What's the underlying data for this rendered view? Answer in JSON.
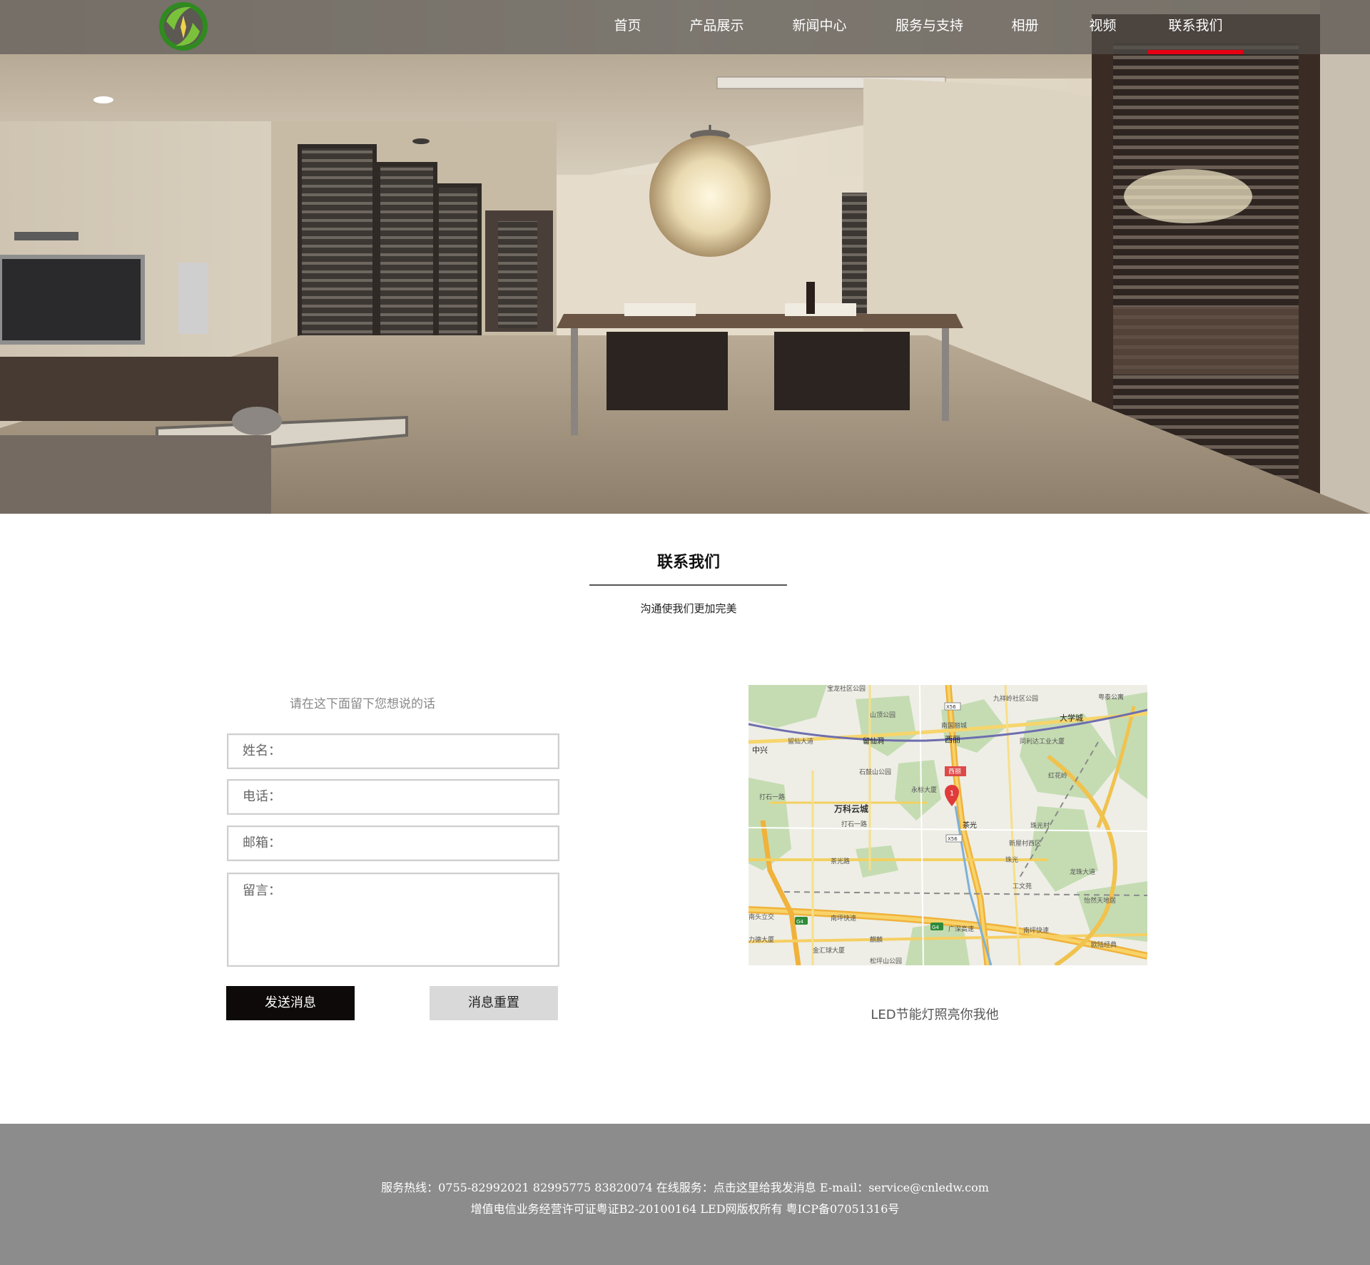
{
  "nav": {
    "items": [
      {
        "label": "首页"
      },
      {
        "label": "产品展示"
      },
      {
        "label": "新闻中心"
      },
      {
        "label": "服务与支持"
      },
      {
        "label": "相册"
      },
      {
        "label": "视频"
      },
      {
        "label": "联系我们"
      }
    ],
    "active_index": 6,
    "active_color": "#e60012"
  },
  "logo": {
    "icon": "green-leaf-circle-logo",
    "color": "#4c9a1f"
  },
  "hero": {
    "image": "modern-dining-room-photo"
  },
  "section": {
    "title": "联系我们",
    "subtitle": "沟通使我们更加完美"
  },
  "form": {
    "hint": "请在这下面留下您想说的话",
    "name_label": "姓名：",
    "phone_label": "电话：",
    "email_label": "邮箱：",
    "message_label": "留言：",
    "send_label": "发送消息",
    "reset_label": "消息重置"
  },
  "map": {
    "caption": "LED节能灯照亮你我他",
    "labels": {
      "park1": "宝龙社区公园",
      "park2": "九祥岭社区公园",
      "park3": "粤泰公寓",
      "park4": "山顶公园",
      "daxuecheng": "大学城",
      "building1": "南国丽城",
      "xili": "西丽",
      "liuxiandong": "留仙洞",
      "liuxiandadao": "留仙大道",
      "zhongxing": "中兴",
      "industry": "同利达工业大厦",
      "shishan": "石鼓山公园",
      "honghua": "红花岭",
      "xili2": "西丽",
      "yongbiao": "永标大厦",
      "wanke": "万科云城",
      "dashi": "打石一路",
      "dashi2": "打石一路",
      "chaguang": "茶光",
      "zhuguang": "珠光村",
      "xinwu": "新屋村西区",
      "chaguang2": "茶光路",
      "zhuguang2": "珠光",
      "longjing": "龙珠大道",
      "wenfa": "工文苑",
      "yiran": "怡然天地居",
      "nantou": "南头立交",
      "nanping": "南坪快速",
      "guangshen": "广深高速",
      "nanping2": "南坪快速",
      "lifeng": "力德大厦",
      "jinhui": "金汇球大厦",
      "shuang": "麒麟",
      "songping": "松坪山公园",
      "ouzhou": "欧陆经典",
      "marker": "1",
      "g4a": "G4",
      "g4b": "G4",
      "s": "X56",
      "s2": "X56"
    }
  },
  "footer": {
    "line1": "服务热线：0755-82992021 82995775 83820074 在线服务：点击这里给我发消息 E-mail：service@cnledw.com",
    "line2": "增值电信业务经营许可证粤证B2-20100164 LED网版权所有 粤ICP备07051316号"
  }
}
